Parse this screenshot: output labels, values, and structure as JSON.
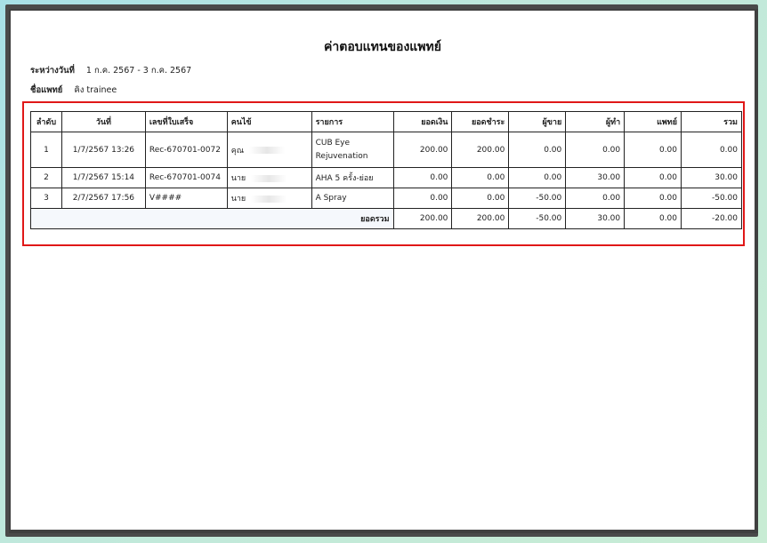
{
  "report": {
    "title": "ค่าตอบแทนของแพทย์",
    "period_label": "ระหว่างวันที่",
    "period_value": "1 ก.ค. 2567 - 3 ก.ค. 2567",
    "doctor_label": "ชื่อแพทย์",
    "doctor_value": "คิง trainee"
  },
  "table": {
    "headers": [
      "ลำดับ",
      "วันที่",
      "เลขที่ใบเสร็จ",
      "คนไข้",
      "รายการ",
      "ยอดเงิน",
      "ยอดชำระ",
      "ผู้ขาย",
      "ผู้ทำ",
      "แพทย์",
      "รวม"
    ],
    "rows": [
      {
        "no": "1",
        "date": "1/7/2567 13:26",
        "receipt": "Rec-670701-0072",
        "patient": "คุณ",
        "item": "CUB Eye",
        "item_line2": "Rejuvenation",
        "amount": "200.00",
        "paid": "200.00",
        "seller": "0.00",
        "doer": "0.00",
        "doctor": "0.00",
        "total": "0.00"
      },
      {
        "no": "2",
        "date": "1/7/2567 15:14",
        "receipt": "Rec-670701-0074",
        "patient": "นาย",
        "item": "AHA 5 ครั้ง-ย่อย",
        "amount": "0.00",
        "paid": "0.00",
        "seller": "0.00",
        "doer": "30.00",
        "doctor": "0.00",
        "total": "30.00"
      },
      {
        "no": "3",
        "date": "2/7/2567 17:56",
        "receipt": "V####",
        "patient": "นาย",
        "item": "A Spray",
        "amount": "0.00",
        "paid": "0.00",
        "seller": "-50.00",
        "doer": "0.00",
        "doctor": "0.00",
        "total": "-50.00"
      }
    ],
    "summary": {
      "label": "ยอดรวม",
      "amount": "200.00",
      "paid": "200.00",
      "seller": "-50.00",
      "doer": "30.00",
      "doctor": "0.00",
      "total": "-20.00"
    }
  },
  "colors": {
    "highlight_border": "#e01818",
    "frame": "#404040"
  }
}
